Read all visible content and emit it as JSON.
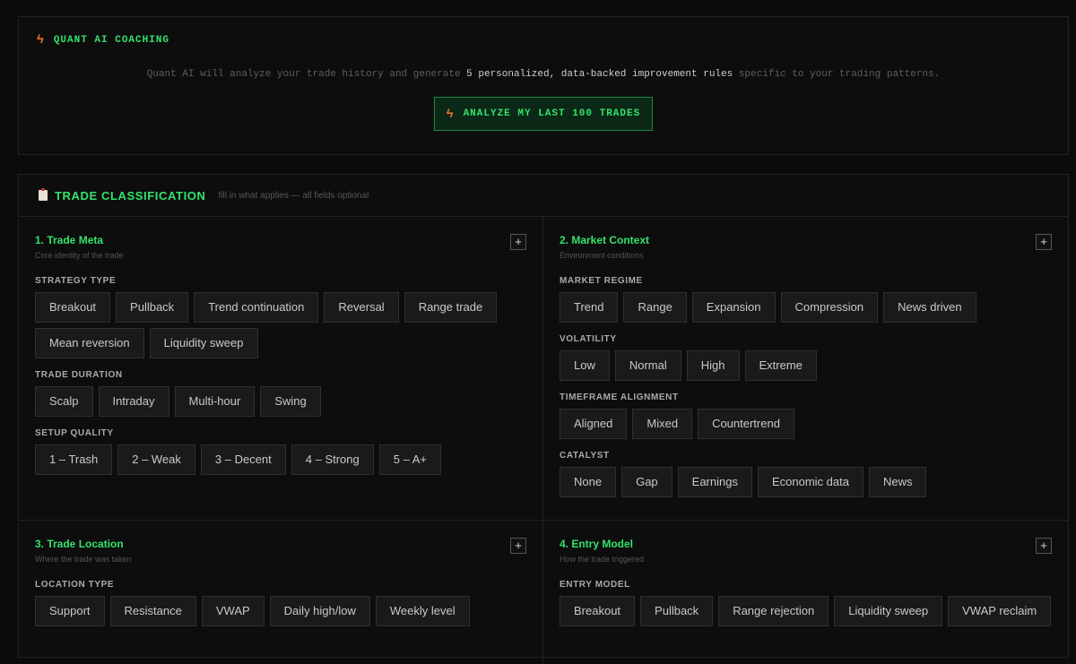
{
  "coaching": {
    "title": "QUANT AI COACHING",
    "desc_pre": "Quant AI will analyze your trade history and generate ",
    "desc_bold": "5 personalized, data-backed improvement rules",
    "desc_post": " specific to your trading patterns.",
    "button_label": "ANALYZE MY LAST 100 TRADES"
  },
  "classification": {
    "title": "TRADE CLASSIFICATION",
    "subtitle": "fill in what applies — all fields optional"
  },
  "panels": [
    {
      "title": "1. Trade Meta",
      "subtitle": "Core identity of the trade",
      "add_label": "+",
      "groups": [
        {
          "label": "STRATEGY TYPE",
          "options": [
            "Breakout",
            "Pullback",
            "Trend continuation",
            "Reversal",
            "Range trade",
            "Mean reversion",
            "Liquidity sweep"
          ]
        },
        {
          "label": "TRADE DURATION",
          "options": [
            "Scalp",
            "Intraday",
            "Multi-hour",
            "Swing"
          ]
        },
        {
          "label": "SETUP QUALITY",
          "options": [
            "1 – Trash",
            "2 – Weak",
            "3 – Decent",
            "4 – Strong",
            "5 – A+"
          ]
        }
      ]
    },
    {
      "title": "2. Market Context",
      "subtitle": "Environment conditions",
      "add_label": "+",
      "groups": [
        {
          "label": "MARKET REGIME",
          "options": [
            "Trend",
            "Range",
            "Expansion",
            "Compression",
            "News driven"
          ]
        },
        {
          "label": "VOLATILITY",
          "options": [
            "Low",
            "Normal",
            "High",
            "Extreme"
          ]
        },
        {
          "label": "TIMEFRAME ALIGNMENT",
          "options": [
            "Aligned",
            "Mixed",
            "Countertrend"
          ]
        },
        {
          "label": "CATALYST",
          "options": [
            "None",
            "Gap",
            "Earnings",
            "Economic data",
            "News"
          ]
        }
      ]
    },
    {
      "title": "3. Trade Location",
      "subtitle": "Where the trade was taken",
      "add_label": "+",
      "groups": [
        {
          "label": "LOCATION TYPE",
          "options": [
            "Support",
            "Resistance",
            "VWAP",
            "Daily high/low",
            "Weekly level"
          ]
        }
      ]
    },
    {
      "title": "4. Entry Model",
      "subtitle": "How the trade triggered",
      "add_label": "+",
      "groups": [
        {
          "label": "ENTRY MODEL",
          "options": [
            "Breakout",
            "Pullback",
            "Range rejection",
            "Liquidity sweep",
            "VWAP reclaim"
          ]
        }
      ]
    }
  ]
}
